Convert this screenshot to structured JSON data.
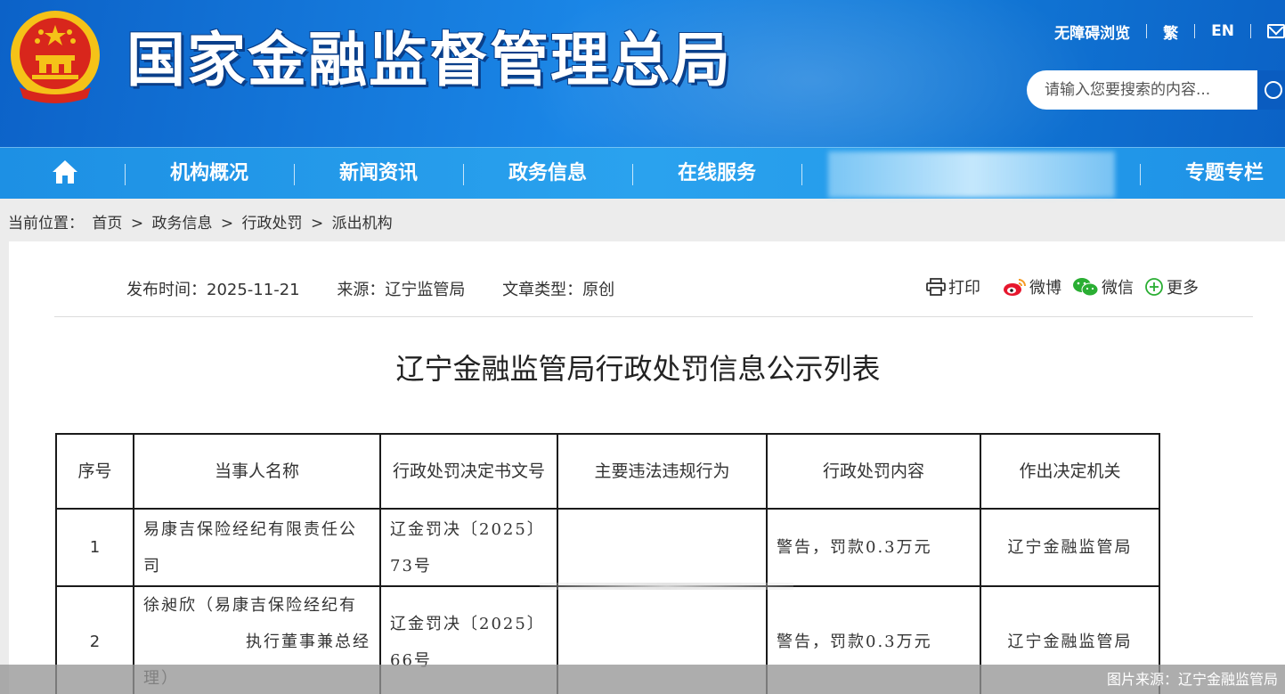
{
  "header": {
    "site_title": "国家金融监督管理总局",
    "links": {
      "accessibility": "无障碍浏览",
      "traditional": "繁",
      "english": "EN"
    },
    "search_placeholder": "请输入您要搜索的内容..."
  },
  "nav": {
    "items": [
      "机构概况",
      "新闻资讯",
      "政务信息",
      "在线服务",
      "专题专栏"
    ]
  },
  "breadcrumb": {
    "label": "当前位置：",
    "items": [
      "首页",
      "政务信息",
      "行政处罚",
      "派出机构"
    ],
    "separator": ">"
  },
  "article": {
    "publish_time": "发布时间：2025-11-21",
    "source": "来源：辽宁监管局",
    "article_type": "文章类型：原创",
    "share": {
      "print": "打印",
      "weibo": "微博",
      "wechat": "微信",
      "more": "更多"
    },
    "title": "辽宁金融监管局行政处罚信息公示列表"
  },
  "table": {
    "headers": [
      "序号",
      "当事人名称",
      "行政处罚决定书文号",
      "主要违法违规行为",
      "行政处罚内容",
      "作出决定机关"
    ],
    "rows": [
      {
        "no": "1",
        "party": "易康吉保险经纪有限责任公司",
        "doc_no": "辽金罚决〔2025〕73号",
        "violation": "",
        "penalty": "警告，罚款0.3万元",
        "authority": "辽宁金融监管局"
      },
      {
        "no": "2",
        "party_line1": "徐昶欣（易康吉保险经纪有",
        "party_line2": "执行董事兼总经",
        "party_line3": "理）",
        "doc_no": "辽金罚决〔2025〕66号",
        "violation": "",
        "penalty": "警告，罚款0.3万元",
        "authority": "辽宁金融监管局"
      }
    ]
  },
  "caption": "图片来源：辽宁金融监管局",
  "colors": {
    "header_blue": "#1582dc",
    "nav_blue": "#27a0ec",
    "emblem_red": "#d8261c",
    "emblem_gold": "#f5c218"
  }
}
